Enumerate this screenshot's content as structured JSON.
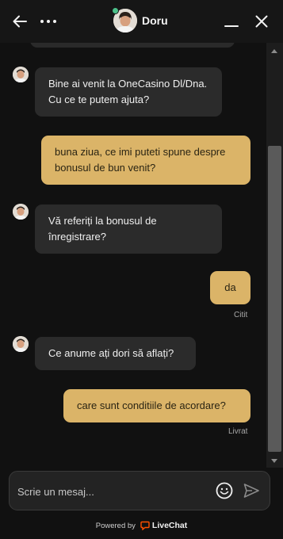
{
  "header": {
    "agent_name": "Doru",
    "agent_status_color": "#4cc08a",
    "icons": {
      "back": "arrow-left-icon",
      "more": "more-horizontal-icon",
      "minimize": "minimize-icon",
      "close": "close-icon"
    }
  },
  "messages": [
    {
      "from": "agent",
      "text": "Bine ai venit la OneCasino Dl/Dna. Cu ce te putem ajuta?"
    },
    {
      "from": "user",
      "text": "buna ziua, ce imi puteti spune despre bonusul de bun venit?"
    },
    {
      "from": "agent",
      "text": "Vă referiți la bonusul de înregistrare?"
    },
    {
      "from": "user",
      "text": "da",
      "status": "Citit"
    },
    {
      "from": "agent",
      "text": "Ce anume ați dori să aflați?"
    },
    {
      "from": "user",
      "text": "care sunt conditiile de acordare?",
      "status": "Livrat"
    }
  ],
  "composer": {
    "placeholder": "Scrie un mesaj...",
    "emoji_icon": "smiley-icon",
    "send_icon": "send-icon"
  },
  "footer": {
    "powered_by": "Powered by",
    "brand": "LiveChat",
    "brand_color": "#ff5100"
  },
  "colors": {
    "background": "#111111",
    "agent_bubble": "#2b2b2b",
    "user_bubble": "#dbb468"
  }
}
